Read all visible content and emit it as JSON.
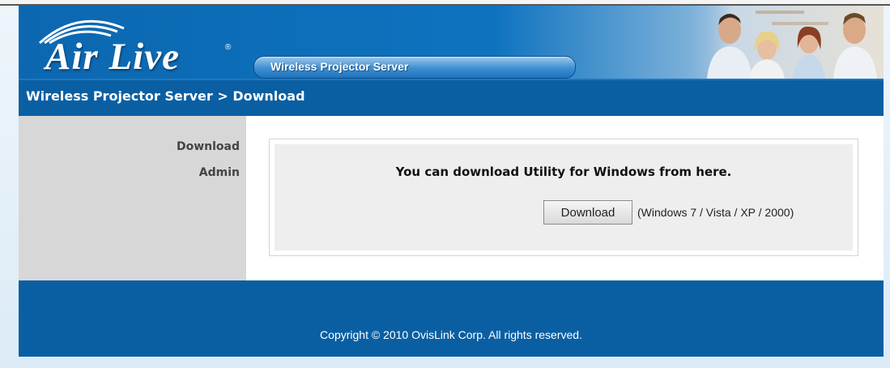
{
  "header": {
    "logo_text": "Air Live",
    "logo_mark": "®",
    "product_banner": "Wireless Projector Server",
    "photo": "team-photo"
  },
  "titlebar": {
    "breadcrumb": "Wireless Projector Server > Download"
  },
  "sidebar": {
    "items": [
      {
        "label": "Download"
      },
      {
        "label": "Admin"
      }
    ]
  },
  "main": {
    "message": "You can download Utility for Windows from here.",
    "download_button": "Download",
    "os_note": "(Windows 7 / Vista / XP / 2000)"
  },
  "footer": {
    "copyright": "Copyright © 2010 OvisLink Corp. All rights reserved."
  },
  "colors": {
    "brand_blue": "#0a5fa3",
    "sidebar_gray": "#d7d7d7",
    "panel_gray": "#eeeeee"
  }
}
